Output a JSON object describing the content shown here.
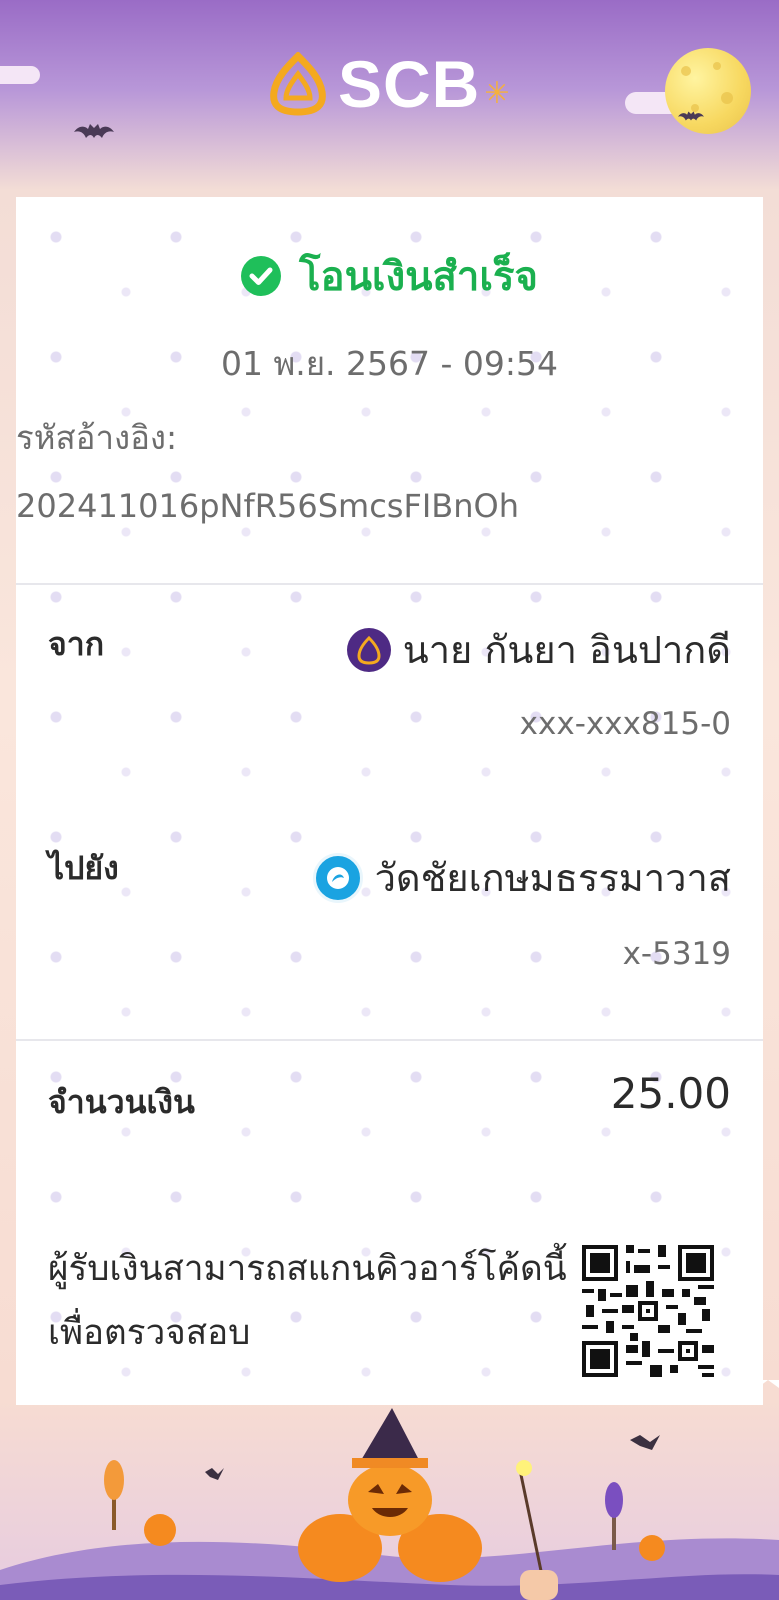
{
  "brand": {
    "name": "SCB",
    "star": "✳",
    "color_gold": "#f4a91f"
  },
  "receipt": {
    "status": "โอนเงินสำเร็จ",
    "status_icon": "check-circle-icon",
    "datetime": "01 พ.ย. 2567 - 09:54",
    "reference_label": "รหัสอ้างอิง:",
    "reference_value": "202411016pNfR56SmcsFIBnOh",
    "from": {
      "label": "จาก",
      "name": "นาย กันยา อินปากดี",
      "account": "xxx-xxx815-0",
      "bank_icon": "scb-bank-icon"
    },
    "to": {
      "label": "ไปยัง",
      "name": "วัดชัยเกษมธรรมาวาส",
      "account": "x-5319",
      "bank_icon": "ktb-bank-icon"
    },
    "amount": {
      "label": "จำนวนเงิน",
      "value": "25.00"
    },
    "qr_note": "ผู้รับเงินสามารถสแกนคิวอาร์โค้ดนี้เพื่อตรวจสอบ"
  },
  "colors": {
    "success": "#1fbf5a",
    "header_purple": "#9a6cc6",
    "scb_purple": "#4e2a84",
    "ktb_blue": "#1aa3e1"
  }
}
